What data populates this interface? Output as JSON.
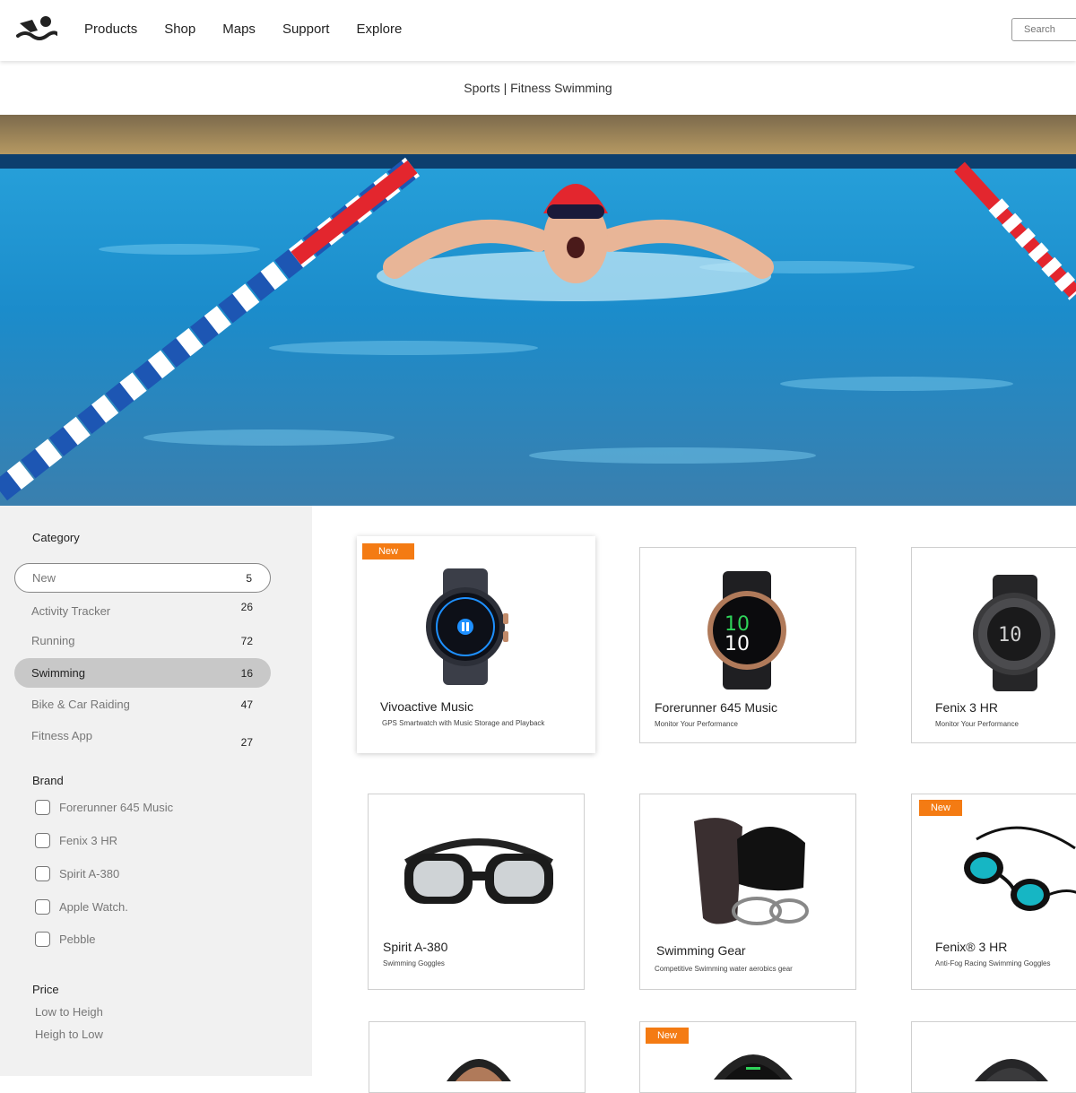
{
  "nav": {
    "items": [
      "Products",
      "Shop",
      "Maps",
      "Support",
      "Explore"
    ],
    "search_placeholder": "Search"
  },
  "breadcrumb": "Sports | Fitness Swimming",
  "sidebar": {
    "category_title": "Category",
    "categories": [
      {
        "label": "New",
        "count": "5"
      },
      {
        "label": "Activity Tracker",
        "count": "26"
      },
      {
        "label": "Running",
        "count": "72"
      },
      {
        "label": "Swimming",
        "count": "16"
      },
      {
        "label": "Bike & Car Raiding",
        "count": "47"
      },
      {
        "label": "Fitness App",
        "count": "27"
      }
    ],
    "brand_title": "Brand",
    "brands": [
      "Forerunner 645 Music",
      "Fenix 3 HR",
      "Spirit A-380",
      "Apple Watch.",
      "Pebble"
    ],
    "price_title": "Price",
    "price_options": [
      "Low to Heigh",
      "Heigh to Low"
    ]
  },
  "products": [
    {
      "name": "Vivoactive Music",
      "desc": "GPS Smartwatch with Music Storage and Playback",
      "badge": "New"
    },
    {
      "name": "Forerunner 645 Music",
      "desc": "Monitor Your Performance"
    },
    {
      "name": "Fenix 3 HR",
      "desc": "Monitor Your Performance"
    },
    {
      "name": "Spirit A-380",
      "desc": "Swimming Goggles"
    },
    {
      "name": "Swimming Gear",
      "desc": "Competitive Swimming water aerobics gear"
    },
    {
      "name": "Fenix® 3 HR",
      "desc": "Anti-Fog Racing Swimming Goggles",
      "badge": "New"
    },
    {
      "badge": "New"
    }
  ],
  "colors": {
    "badge": "#f47b13",
    "accent_swimcap": "#e8202a",
    "water": "#1d8fd0"
  }
}
